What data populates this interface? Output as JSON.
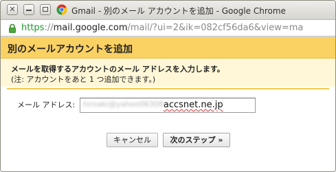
{
  "window": {
    "title": "Gmail - 別のメール アカウントを追加 - Google Chrome",
    "controls": [
      "close",
      "minimize",
      "maximize"
    ]
  },
  "address_bar": {
    "scheme": "https",
    "separator": "://",
    "host": "mail.google.com",
    "path": "/mail/?ui=2&ik=082cf56da6&view=ma"
  },
  "dialog": {
    "title": "別のメールアカウントを追加",
    "instruction": "メールを取得するアカウントのメール アドレスを入力します。",
    "note": "(注: アカウントをあと 1 つ追加できます。)",
    "email_label": "メール アドレス:",
    "email_value_redacted": "hiroaki@yahoo06308",
    "email_value_domain": "accsnet.ne.jp",
    "cancel_label": "キャンセル",
    "next_label": "次のステップ »"
  },
  "colors": {
    "header_bg": "#fad163",
    "intro_bg": "#fff7d7",
    "url_scheme": "#1a9a2c"
  }
}
